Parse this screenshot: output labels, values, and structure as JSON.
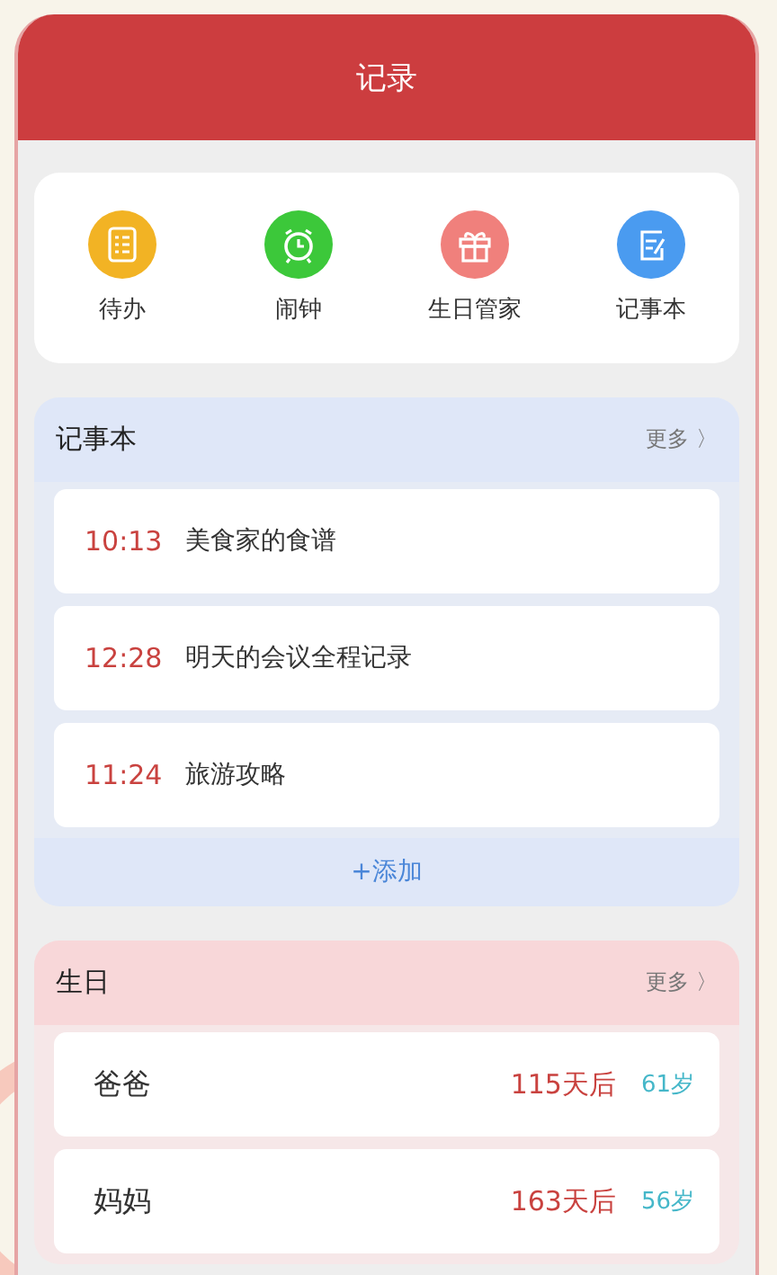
{
  "header": {
    "title": "记录"
  },
  "shortcuts": [
    {
      "label": "待办",
      "kind": "todo",
      "color": "#f2b324"
    },
    {
      "label": "闹钟",
      "kind": "alarm",
      "color": "#3cc83a"
    },
    {
      "label": "生日管家",
      "kind": "gift",
      "color": "#f0807c"
    },
    {
      "label": "记事本",
      "kind": "note",
      "color": "#4a9bf0"
    }
  ],
  "notebook": {
    "title": "记事本",
    "more": "更多 〉",
    "add": "+添加",
    "items": [
      {
        "time": "10:13",
        "text": "美食家的食谱"
      },
      {
        "time": "12:28",
        "text": "明天的会议全程记录"
      },
      {
        "time": "11:24",
        "text": "旅游攻略"
      }
    ]
  },
  "birthdays": {
    "title": "生日",
    "more": "更多 〉",
    "items": [
      {
        "name": "爸爸",
        "countdown": "115天后",
        "age": "61岁"
      },
      {
        "name": "妈妈",
        "countdown": "163天后",
        "age": "56岁"
      }
    ]
  }
}
